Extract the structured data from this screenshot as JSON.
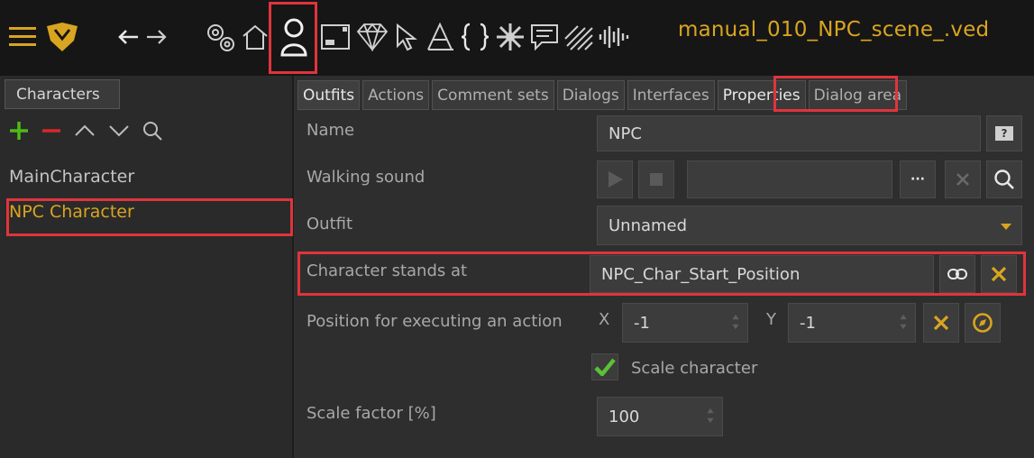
{
  "toolbar": {
    "filename": "manual_010_NPC_scene_.ved",
    "icons": [
      "menu-icon",
      "logo-icon",
      "back-icon",
      "forward-icon",
      "settings-icon",
      "home-icon",
      "character-icon",
      "interface-icon",
      "diamond-icon",
      "cursor-icon",
      "font-icon",
      "braces-icon",
      "particles-icon",
      "dialog-icon",
      "shader-icon",
      "audio-icon"
    ]
  },
  "left": {
    "tab_label": "Characters",
    "tools": [
      "add-icon",
      "remove-icon",
      "move-up-icon",
      "move-down-icon",
      "search-icon"
    ],
    "characters": [
      {
        "label": "MainCharacter"
      },
      {
        "label": "NPC Character"
      }
    ]
  },
  "tabs": [
    {
      "label": "Outfits"
    },
    {
      "label": "Actions"
    },
    {
      "label": "Comment sets"
    },
    {
      "label": "Dialogs"
    },
    {
      "label": "Interfaces"
    },
    {
      "label": "Properties"
    },
    {
      "label": "Dialog area"
    }
  ],
  "properties": {
    "name_label": "Name",
    "name_value": "NPC",
    "help_icon": "?",
    "walking_sound_label": "Walking sound",
    "walking_sound_value": "",
    "more_label": "···",
    "outfit_label": "Outfit",
    "outfit_value": "Unnamed",
    "stands_at_label": "Character stands at",
    "stands_at_value": "NPC_Char_Start_Position",
    "position_label": "Position for executing an action",
    "x_label": "X",
    "x_value": "-1",
    "y_label": "Y",
    "y_value": "-1",
    "scale_character_label": "Scale character",
    "scale_character_checked": true,
    "scale_factor_label": "Scale factor [%]",
    "scale_factor_value": "100"
  },
  "colors": {
    "accent": "#d9a520",
    "highlight": "#e0343c",
    "add": "#4cbb17",
    "remove": "#d8262c",
    "check": "#5bc236"
  }
}
